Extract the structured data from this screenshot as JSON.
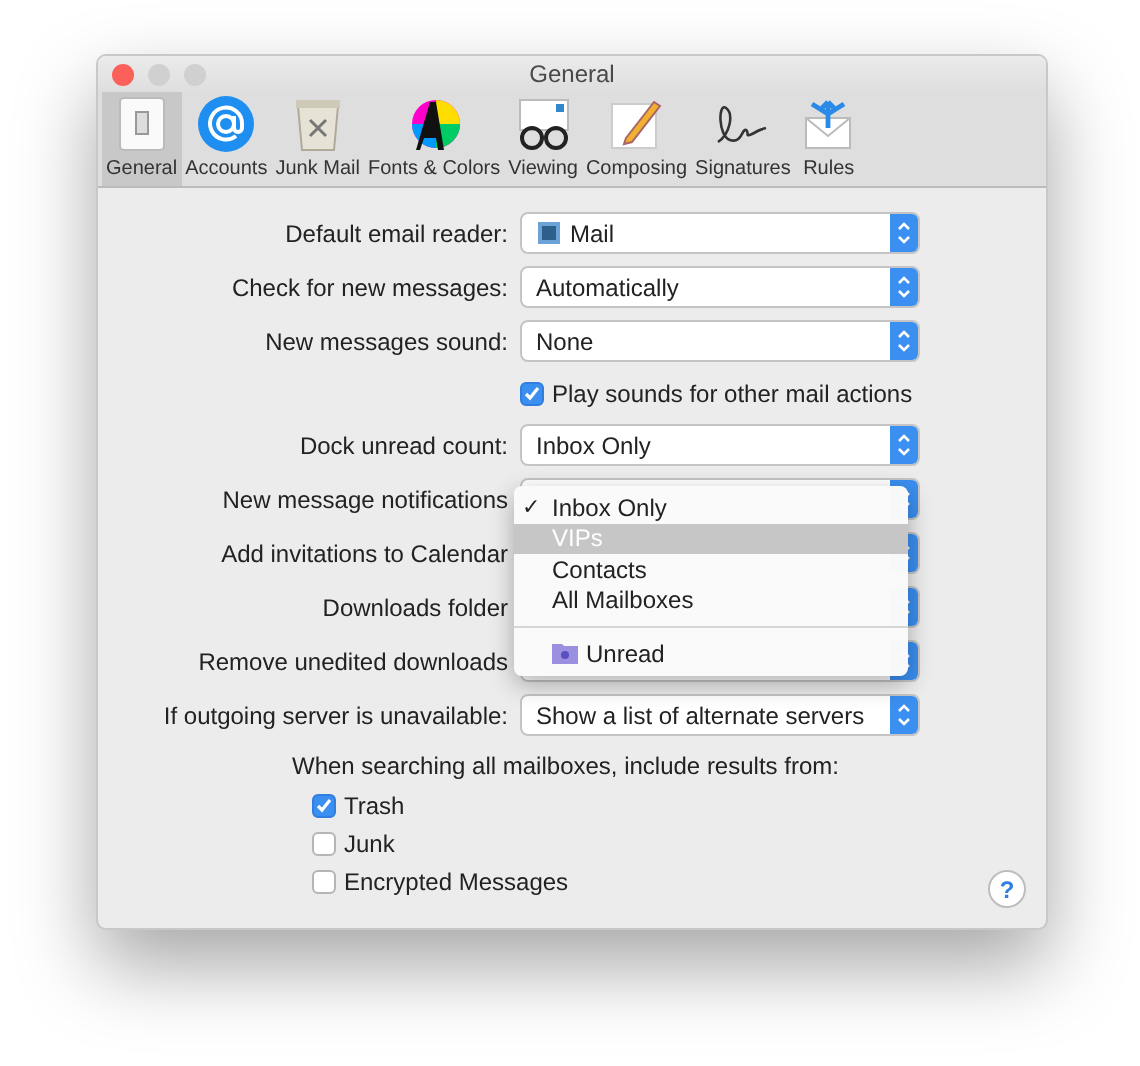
{
  "window": {
    "title": "General"
  },
  "toolbar": [
    {
      "label": "General",
      "selected": true
    },
    {
      "label": "Accounts",
      "selected": false
    },
    {
      "label": "Junk Mail",
      "selected": false
    },
    {
      "label": "Fonts & Colors",
      "selected": false
    },
    {
      "label": "Viewing",
      "selected": false
    },
    {
      "label": "Composing",
      "selected": false
    },
    {
      "label": "Signatures",
      "selected": false
    },
    {
      "label": "Rules",
      "selected": false
    }
  ],
  "rows": [
    {
      "kind": "popup",
      "label": "Default email reader:",
      "value": "Mail",
      "app_icon": true
    },
    {
      "kind": "popup",
      "label": "Check for new messages:",
      "value": "Automatically"
    },
    {
      "kind": "popup",
      "label": "New messages sound:",
      "value": "None"
    },
    {
      "kind": "checkbox",
      "label": "Play sounds for other mail actions",
      "checked": true
    },
    {
      "kind": "popup",
      "label": "Dock unread count:",
      "value": "Inbox Only"
    },
    {
      "kind": "popup",
      "label": "New message notifications"
    },
    {
      "kind": "popup",
      "label": "Add invitations to Calendar"
    },
    {
      "kind": "popup",
      "label": "Downloads folder"
    },
    {
      "kind": "popup",
      "label": "Remove unedited downloads"
    },
    {
      "kind": "popup",
      "label": "If outgoing server is unavailable:",
      "value": "Show a list of alternate servers"
    }
  ],
  "menu": {
    "check_mark": "✓",
    "items": [
      {
        "kind": "item",
        "label": "Inbox Only",
        "checked": true,
        "selected": false
      },
      {
        "kind": "item",
        "label": "VIPs",
        "checked": false,
        "selected": true
      },
      {
        "kind": "item",
        "label": "Contacts",
        "checked": false,
        "selected": false
      },
      {
        "kind": "item",
        "label": "All Mailboxes",
        "checked": false,
        "selected": false
      },
      {
        "kind": "separator"
      },
      {
        "kind": "mailbox",
        "label": "Unread",
        "checked": false,
        "selected": false
      }
    ]
  },
  "search": {
    "heading": "When searching all mailboxes, include results from:",
    "options": [
      {
        "label": "Trash",
        "checked": true
      },
      {
        "label": "Junk",
        "checked": false
      },
      {
        "label": "Encrypted Messages",
        "checked": false
      }
    ]
  },
  "help": {
    "label": "?"
  }
}
